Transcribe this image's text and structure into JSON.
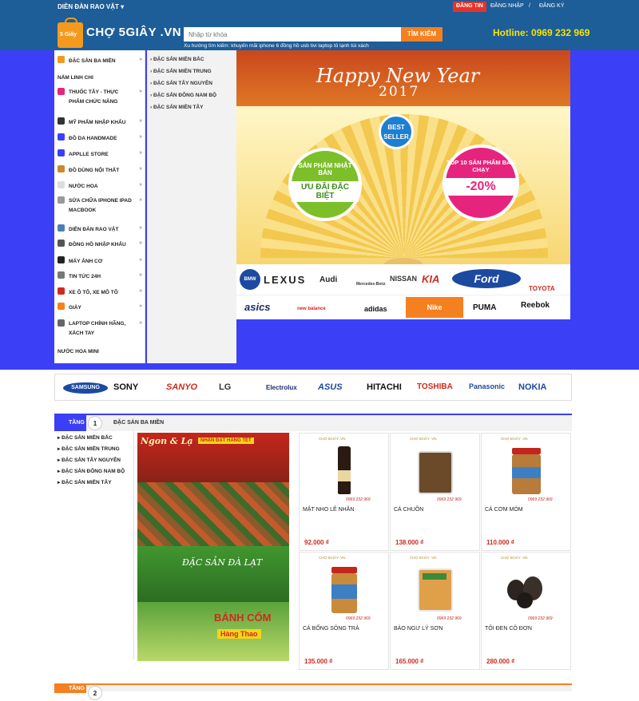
{
  "topbar": {
    "forum": "DIỄN ĐÀN RAO VẶT",
    "post_button": "ĐĂNG TIN",
    "login": "ĐĂNG NHẬP",
    "separator": "/",
    "register": "ĐĂNG KÝ"
  },
  "header": {
    "logo_badge": "5 Giây",
    "logo_text": "CHỢ 5GIÂY .VN",
    "search_placeholder": "Nhập từ khóa",
    "search_button": "TÌM KIẾM",
    "suggest_label": "Xu hướng tìm kiếm:",
    "suggest_items": [
      "khuyến mãi",
      "iphone 6",
      "đồng hồ",
      "usb",
      "tivi",
      "laptop",
      "tủ lạnh",
      "túi xách"
    ],
    "hotline_label": "Hotline:",
    "hotline_number": "0969 232 969"
  },
  "sidebar": {
    "items": [
      {
        "label": "ĐẶC SẢN BA MIỀN",
        "icon": "basket-icon"
      },
      {
        "label": "NẤM LINH CHI",
        "icon": ""
      },
      {
        "label": "THUỐC TÂY - THỰC PHẨM CHỨC NĂNG",
        "icon": "pill-icon"
      },
      {
        "label": "MỸ PHẨM NHẬP KHẨU",
        "icon": "cosmetic-icon"
      },
      {
        "label": "ĐỒ DA HANDMADE",
        "icon": "bag-icon"
      },
      {
        "label": "APPLLE STORE",
        "icon": "apple-icon"
      },
      {
        "label": "ĐỒ DÙNG NỘI THẤT",
        "icon": "furniture-icon"
      },
      {
        "label": "NƯỚC HOA",
        "icon": "perfume-icon"
      },
      {
        "label": "SỬA CHỮA IPHONE IPAD MACBOOK",
        "icon": "repair-icon"
      },
      {
        "label": "DIỄN ĐÀN RAO VẶT",
        "icon": "forum-icon"
      },
      {
        "label": "ĐỒNG HỒ NHẬP KHẨU",
        "icon": "watch-icon"
      },
      {
        "label": "MÁY ẢNH CƠ",
        "icon": "camera-icon"
      },
      {
        "label": "TIN TỨC 24H",
        "icon": "news-icon"
      },
      {
        "label": "XE Ô TÔ, XE MÔ TÔ",
        "icon": "car-icon"
      },
      {
        "label": "GIÀY",
        "icon": "shoe-icon"
      },
      {
        "label": "LAPTOP CHÍNH HÃNG, XÁCH TAY",
        "icon": "laptop-icon"
      },
      {
        "label": "NƯỚC HOA MINI",
        "icon": ""
      }
    ]
  },
  "submenu": {
    "items": [
      "ĐẶC SẢN MIỀN BẮC",
      "ĐẶC SẢN MIỀN TRUNG",
      "ĐẶC SẢN TÂY NGUYÊN",
      "ĐẶC SẢN ĐÔNG NAM BỘ",
      "ĐẶC SẢN MIỀN TÂY"
    ]
  },
  "banner": {
    "greeting": "Happy New Year",
    "year": "2017",
    "badge_best": "BEST SELLER",
    "left_circle_top": "SẢN PHẨM NHẬT BẢN",
    "left_circle_bottom": "ƯU ĐÃI ĐẶC BIỆT",
    "right_circle_top": "TOP 10 SẢN PHẨM BÁN CHẠY",
    "right_circle_bottom": "-20%",
    "car_brands": [
      "BMW",
      "LEXUS",
      "Audi",
      "Mercedes-Benz",
      "NISSAN",
      "KIA",
      "Ford",
      "TOYOTA"
    ],
    "sport_brands": [
      "asics",
      "new balance",
      "adidas",
      "Nike",
      "PUMA",
      "Reebok"
    ]
  },
  "brandbar": {
    "items": [
      "SAMSUNG",
      "SONY",
      "SANYO",
      "LG",
      "Electrolux",
      "ASUS",
      "HITACHI",
      "TOSHIBA",
      "Panasonic",
      "NOKIA"
    ]
  },
  "section1": {
    "tang_label": "TẦNG",
    "number": "1",
    "title": "ĐẶC SẢN BA MIỀN",
    "side_items": [
      "ĐẶC SẢN MIỀN BẮC",
      "ĐẶC SẢN MIỀN TRUNG",
      "ĐẶC SẢN TÂY NGUYÊN",
      "ĐẶC SẢN ĐÔNG NAM BỘ",
      "ĐẶC SẢN MIỀN TÂY"
    ],
    "promo": {
      "title": "Ngon & Lạ",
      "badge": "NHẬN ĐẶT HÀNG TẾT",
      "subtitle": "ĐẶC SẢN ĐÀ LẠT",
      "cake": "BÁNH CỐM",
      "cake_sub": "Hàng Thao"
    },
    "products": [
      {
        "name": "MẬT NHO LÊ NHÂN",
        "price": "92.000 ₫",
        "brand": "CHỢ 5GIÂY .VN",
        "phone": "0969 232 969"
      },
      {
        "name": "CÁ CHUỒN",
        "price": "138.000 ₫",
        "brand": "CHỢ 5GIÂY .VN",
        "phone": "0969 232 969"
      },
      {
        "name": "CÁ CƠM MÓM",
        "price": "110.000 ₫",
        "brand": "CHỢ 5GIÂY .VN",
        "phone": "0969 232 969"
      },
      {
        "name": "CÁ BỐNG SÔNG TRÀ",
        "price": "135.000 ₫",
        "brand": "CHỢ 5GIÂY .VN",
        "phone": "0969 232 969"
      },
      {
        "name": "BÀO NGƯ LÝ SƠN",
        "price": "165.000 ₫",
        "brand": "CHỢ 5GIÂY .VN",
        "phone": "0969 232 969"
      },
      {
        "name": "TỎI ĐEN CÔ ĐƠN",
        "price": "280.000 ₫",
        "brand": "CHỢ 5GIÂY .VN",
        "phone": "0969 232 969"
      }
    ]
  },
  "section2": {
    "tang_label": "TẦNG",
    "number": "2"
  },
  "colors": {
    "header_blue": "#1d5d98",
    "band_blue": "#3b3ff5",
    "accent_orange": "#f5801f",
    "price_red": "#cf2a1e",
    "hotline_yellow": "#f6e500"
  }
}
